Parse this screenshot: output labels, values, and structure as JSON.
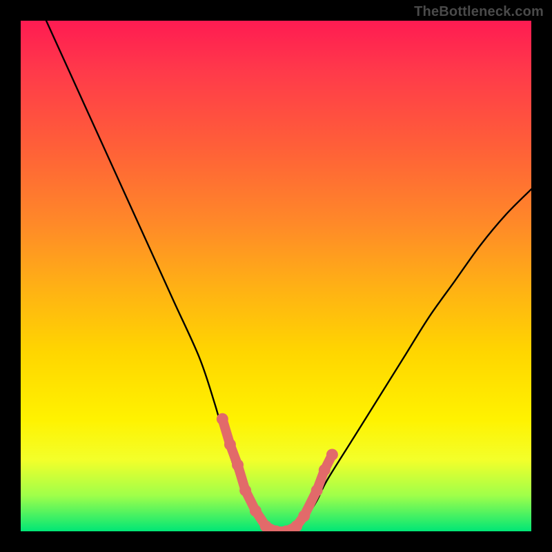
{
  "watermark": "TheBottleneck.com",
  "chart_data": {
    "type": "line",
    "title": "",
    "xlabel": "",
    "ylabel": "",
    "xlim": [
      0,
      100
    ],
    "ylim": [
      0,
      100
    ],
    "series": [
      {
        "name": "bottleneck-curve",
        "x": [
          5,
          10,
          15,
          20,
          25,
          30,
          35,
          38,
          40,
          42,
          44,
          46,
          48,
          50,
          52,
          54,
          56,
          58,
          60,
          65,
          70,
          75,
          80,
          85,
          90,
          95,
          100
        ],
        "values": [
          100,
          89,
          78,
          67,
          56,
          45,
          34,
          25,
          18,
          12,
          7,
          3,
          1,
          0,
          0,
          1,
          3,
          6,
          10,
          18,
          26,
          34,
          42,
          49,
          56,
          62,
          67
        ]
      }
    ],
    "markers": {
      "name": "highlight-dots",
      "color": "#e26a6a",
      "x": [
        39.5,
        41,
        42.5,
        44,
        46,
        48,
        50,
        52,
        54,
        55.5,
        58,
        59.5,
        61
      ],
      "values": [
        22,
        17,
        13,
        8,
        4,
        1,
        0,
        0,
        1,
        3,
        8,
        12,
        15
      ]
    },
    "gradient_stops": [
      {
        "pos": 0.0,
        "color": "#ff1b52"
      },
      {
        "pos": 0.25,
        "color": "#ff6038"
      },
      {
        "pos": 0.52,
        "color": "#ffb015"
      },
      {
        "pos": 0.78,
        "color": "#fff200"
      },
      {
        "pos": 0.93,
        "color": "#9fff4a"
      },
      {
        "pos": 1.0,
        "color": "#00e676"
      }
    ]
  }
}
